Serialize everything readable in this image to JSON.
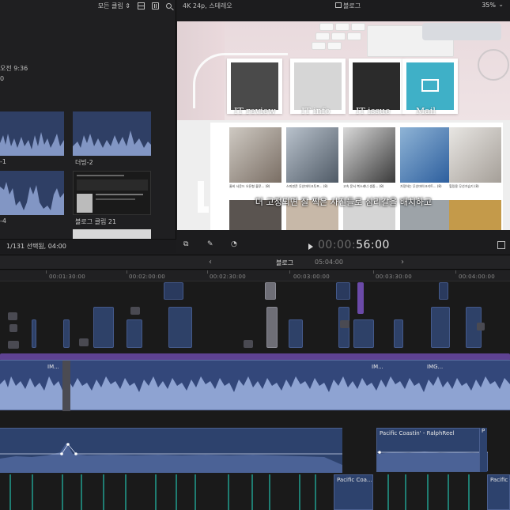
{
  "browser": {
    "filter_label": "모든 클립 ⇕",
    "meta_line1": "오전 9:36",
    "meta_line2": "0",
    "clips": [
      {
        "label": "-1"
      },
      {
        "label": "더빙-2"
      },
      {
        "label": "-4"
      },
      {
        "label": "블로그 클립 21"
      }
    ],
    "status": "1/131 선택됨, 04:00"
  },
  "viewer": {
    "format": "4K 24p, 스테레오",
    "title": "블로그",
    "zoom": "35%",
    "card_labels": [
      "IT review",
      "IT info",
      "IT issue",
      "Mail"
    ],
    "subtitle": "더 고정되면 잘 찍은 사진들로 심리갈을 배치하고",
    "post_captions": [
      "줄비 사운드 오픈형 블루... (8)",
      "스피핀콘 무선마이크투프... (8)",
      "고속 문서 복스캐너 생중... (8)",
      "가정하는 무선마이크키트... (8)",
      "힐링용 무선가습기 (8)"
    ],
    "timecode_dim": "00:00:",
    "timecode": "56:00"
  },
  "timeline_header": {
    "project": "블로그",
    "duration": "05:04:00"
  },
  "ruler": [
    "00:01:30:00",
    "00:02:00:00",
    "00:02:30:00",
    "00:03:00:00",
    "00:03:30:00",
    "00:04:00:00"
  ],
  "timeline": {
    "primary_clip_names": [
      "IM...",
      "IM...",
      "IMG..."
    ],
    "music_clip": "Pacific Coastin' - RalphReel",
    "music_clip_short": "P",
    "fx_clip_1": "Pacific Coa...",
    "fx_clip_2": "Pacific Coa..."
  },
  "colors": {
    "clip_blue": "#33477a",
    "title_purple": "#6b4aa8",
    "fx_teal": "#1f7d72"
  }
}
